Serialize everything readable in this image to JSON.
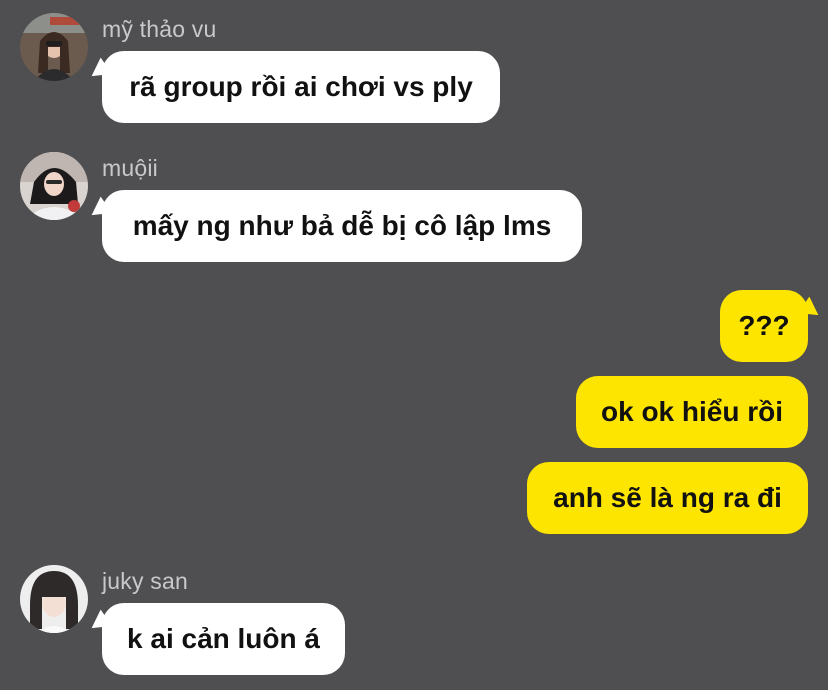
{
  "messages": [
    {
      "sender": "mỹ thảo vu",
      "text": "rã group rồi ai chơi vs ply"
    },
    {
      "sender": "muộii",
      "text": "mấy ng như bả dễ bị cô lập lms"
    },
    {
      "text": "???"
    },
    {
      "text": "ok ok hiểu rồi"
    },
    {
      "text": "anh sẽ là ng ra đi"
    },
    {
      "sender": "juky san",
      "text": "k ai cản luôn á"
    }
  ],
  "colors": {
    "background": "#4f4e50",
    "incoming_bubble": "#ffffff",
    "outgoing_bubble": "#fee500",
    "sender_name": "#c9c8ca",
    "message_text": "#111111"
  }
}
